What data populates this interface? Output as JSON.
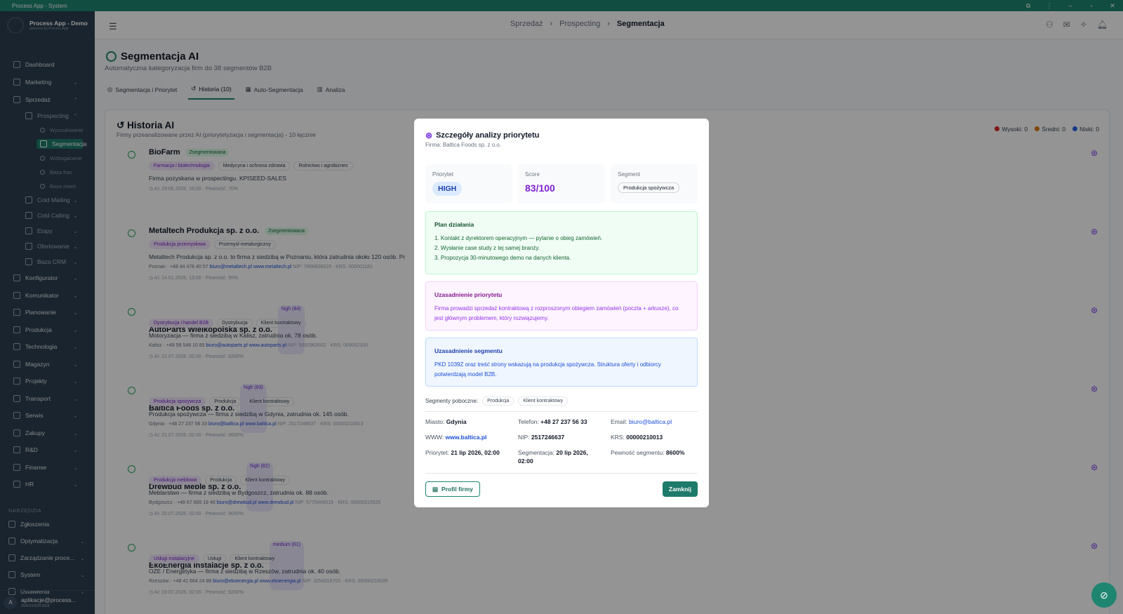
{
  "window": {
    "title": "Process App - System",
    "controls": [
      "⧉",
      "⋮",
      "–",
      "▫",
      "✕"
    ]
  },
  "brand": {
    "name": "Process App - Demo",
    "tagline": "powered by Process App"
  },
  "sidebar": {
    "items": [
      {
        "label": "Dashboard",
        "icon": "dashboard-icon"
      },
      {
        "label": "Marketing",
        "icon": "megaphone-icon"
      },
      {
        "label": "Sprzedaż",
        "icon": "trending-icon"
      },
      {
        "label": "Prospecting",
        "icon": "target-icon"
      },
      {
        "label": "Wyszukiwanie",
        "icon": "search-icon"
      },
      {
        "label": "Segmentacja",
        "icon": "pie-icon"
      },
      {
        "label": "Wzbogacanie",
        "icon": "sparkle-icon"
      },
      {
        "label": "Baza fraz",
        "icon": "tag-icon"
      },
      {
        "label": "Baza miast",
        "icon": "city-icon"
      },
      {
        "label": "Cold Mailing",
        "icon": "send-icon"
      },
      {
        "label": "Cold Calling",
        "icon": "phone-icon"
      },
      {
        "label": "Etapy",
        "icon": "stages-icon"
      },
      {
        "label": "Ofertowanie",
        "icon": "offer-icon"
      },
      {
        "label": "Baza CRM",
        "icon": "database-icon"
      },
      {
        "label": "Konfigurator",
        "icon": "sliders-icon"
      },
      {
        "label": "Komunikator",
        "icon": "chat-icon"
      },
      {
        "label": "Planowanie",
        "icon": "calendar-icon"
      },
      {
        "label": "Produkcja",
        "icon": "factory-icon"
      },
      {
        "label": "Technologia",
        "icon": "cog-icon"
      },
      {
        "label": "Magazyn",
        "icon": "box-icon"
      },
      {
        "label": "Projekty",
        "icon": "folder-icon"
      },
      {
        "label": "Transport",
        "icon": "truck-icon"
      },
      {
        "label": "Serwis",
        "icon": "wrench-icon"
      },
      {
        "label": "Zakupy",
        "icon": "cart-icon"
      },
      {
        "label": "R&D",
        "icon": "bulb-icon"
      },
      {
        "label": "Finanse",
        "icon": "wallet-icon"
      },
      {
        "label": "HR",
        "icon": "people-icon"
      }
    ],
    "section": "NARZĘDZIA",
    "tools": [
      {
        "label": "Zgłoszenia",
        "icon": "ticket-icon"
      },
      {
        "label": "Optymalizacja",
        "icon": "bolt-icon"
      },
      {
        "label": "Zarządzanie proce...",
        "icon": "process-icon"
      },
      {
        "label": "System",
        "icon": "system-icon"
      },
      {
        "label": "Ustawienia",
        "icon": "settings-icon"
      }
    ],
    "user": {
      "initial": "A",
      "name": "aplikacje@process...",
      "role": "Administrator"
    }
  },
  "breadcrumb": [
    "Sprzedaż",
    "Prospecting",
    "Segmentacja"
  ],
  "page": {
    "title": "Segmentacja AI",
    "subtitle": "Automatyczna kategoryzacja firm do 38 segmentów B2B",
    "tabs": [
      "Segmentacja i Priorytet",
      "Historia (10)",
      "Auto-Segmentacja",
      "Analiza"
    ]
  },
  "history": {
    "title": "Historia AI",
    "subtitle": "Firmy przeanalizowane przez AI (priorytetyzacja i segmentacja) - 10 łącznie",
    "legend": [
      {
        "label": "Wysoki: 0",
        "color": "#dc2626"
      },
      {
        "label": "Średni: 0",
        "color": "#d97706"
      },
      {
        "label": "Niski: 0",
        "color": "#2563eb"
      }
    ],
    "rows": [
      {
        "name": "BioFarm",
        "badge": "Zsegmentowana",
        "tags": [
          "Farmacja i biotechnologia",
          "Medycyna i ochrona zdrowia",
          "Rolnictwo i agrobiznes"
        ],
        "desc": "Firma pozyskana w prospectingu. KPISEED-SALES",
        "meta": "",
        "email": "",
        "www": "",
        "nipkrs": "",
        "ai": "AI: 29.06.2026, 16:00 · Pewność: 70%"
      },
      {
        "name": "Metaltech Produkcja sp. z o.o.",
        "badge": "Zsegmentowana",
        "tags": [
          "Produkcja przemysłowa",
          "Przemysł metalurgiczny"
        ],
        "desc": "Metaltech Produkcja sp. z o.o. to firma z siedzibą w Poznaniu, która zatrudnia około 120 osób. Pr",
        "meta": "Poznan · +48 44 476 40 57",
        "email": "biuro@metaltech.pl",
        "www": "www.metaltech.pl",
        "nipkrs": "NIP: 7898608319 · KRS: 000001181",
        "ai": "AI: 14.01.2026, 13:00 · Pewność: 95%"
      },
      {
        "name": "AutoParts Wielkopolska sp. z o.o.",
        "badge": "high (84)",
        "tags": [
          "Dystrybucja i handel B2B",
          "Dystrybucja",
          "Klient kontraktowy"
        ],
        "desc": "Motoryzacja — firma z siedzibą w Kalisz, zatrudnia ok. 78 osób.",
        "meta": "Kalisz · +48 58 546 10 85",
        "email": "biuro@autoparts.pl",
        "www": "www.autoparts.pl",
        "nipkrs": "NIP: 5692963502 · KRS: 000002100",
        "ai": "AI: 22.07.2026, 02:00 · Pewność: 8200%"
      },
      {
        "name": "Baltica Foods sp. z o.o.",
        "badge": "high (83)",
        "tags": [
          "Produkcja spożywcza",
          "Produkcja",
          "Klient kontraktowy"
        ],
        "desc": "Produkcja spożywcza — firma z siedzibą w Gdynia, zatrudnia ok. 145 osób.",
        "meta": "Gdynia · +48 27 237 56 33",
        "email": "biuro@baltica.pl",
        "www": "www.baltica.pl",
        "nipkrs": "NIP: 2517246637 · KRS: 00000210013",
        "ai": "AI: 21.07.2026, 02:00 · Pewność: 8600%"
      },
      {
        "name": "Drewbud Meble sp. z o.o.",
        "badge": "high (82)",
        "tags": [
          "Produkcja meblowa",
          "Produkcja",
          "Klient kontraktowy"
        ],
        "desc": "Meblarstwo — firma z siedzibą w Bydgoszcz, zatrudnia ok. 88 osób.",
        "meta": "Bydgoszcz · +48 67 665 19 46",
        "email": "biuro@drewbud.pl",
        "www": "www.drewbud.pl",
        "nipkrs": "NIP: 5775949016 · KRS: 00000210026",
        "ai": "AI: 20.07.2026, 02:00 · Pewność: 9000%"
      },
      {
        "name": "EkoEnergia Instalacje sp. z o.o.",
        "badge": "medium (61)",
        "tags": [
          "Usługi instalacyjne",
          "Usługi",
          "Klient kontraktowy"
        ],
        "desc": "OZE / Energetyka — firma z siedzibą w Rzeszów, zatrudnia ok. 40 osób.",
        "meta": "Rzeszów · +48 41 664 24 88",
        "email": "biuro@ekoenergia.pl",
        "www": "www.ekoenergia.pl",
        "nipkrs": "NIP: 3254316703 · KRS: 00000210039",
        "ai": "AI: 19.07.2026, 02:00 · Pewność: 9200%"
      }
    ]
  },
  "modal": {
    "title": "Szczegóły analizy priorytetu",
    "subtitle": "Firma: Baltica Foods sp. z o.o.",
    "priority_label": "Priorytet",
    "priority_value": "HIGH",
    "score_label": "Score",
    "score_value": "83/100",
    "segment_label": "Segment",
    "segment_value": "Produkcja spożywcza",
    "plan_title": "Plan działania",
    "plan_items": [
      "1. Kontakt z dyrektorem operacyjnym — pytanie o obieg zamówień.",
      "2. Wysłanie case study z tej samej branży.",
      "3. Propozycja 30-minutowego demo na danych klienta."
    ],
    "prio_title": "Uzasadnienie priorytetu",
    "prio_text": "Firma prowadzi sprzedaż kontraktową z rozproszonym obiegiem zamówień (poczta + arkusze), co jest głównym problemem, który rozwiązujemy.",
    "seg_title": "Uzasadnienie segmentu",
    "seg_text": "PKD 1039Z oraz treść strony wskazują na produkcja spożywcza. Struktura oferty i odbiorcy potwierdzają model B2B.",
    "side_label": "Segmenty poboczne:",
    "side_tags": [
      "Produkcja",
      "Klient kontraktowy"
    ],
    "fields": {
      "city_l": "Miasto:",
      "city": "Gdynia",
      "phone_l": "Telefon:",
      "phone": "+48 27 237 56 33",
      "email_l": "Email:",
      "email": "biuro@baltica.pl",
      "www_l": "WWW:",
      "www": "www.baltica.pl",
      "nip_l": "NIP:",
      "nip": "2517246637",
      "krs_l": "KRS:",
      "krs": "00000210013",
      "prio_date_l": "Priorytet:",
      "prio_date": "21 lip 2026, 02:00",
      "seg_date_l": "Segmentacja:",
      "seg_date": "20 lip 2026, 02:00",
      "conf_l": "Pewność segmentu:",
      "conf": "8600%"
    },
    "profile_btn": "Profil firmy",
    "close_btn": "Zamknij"
  }
}
